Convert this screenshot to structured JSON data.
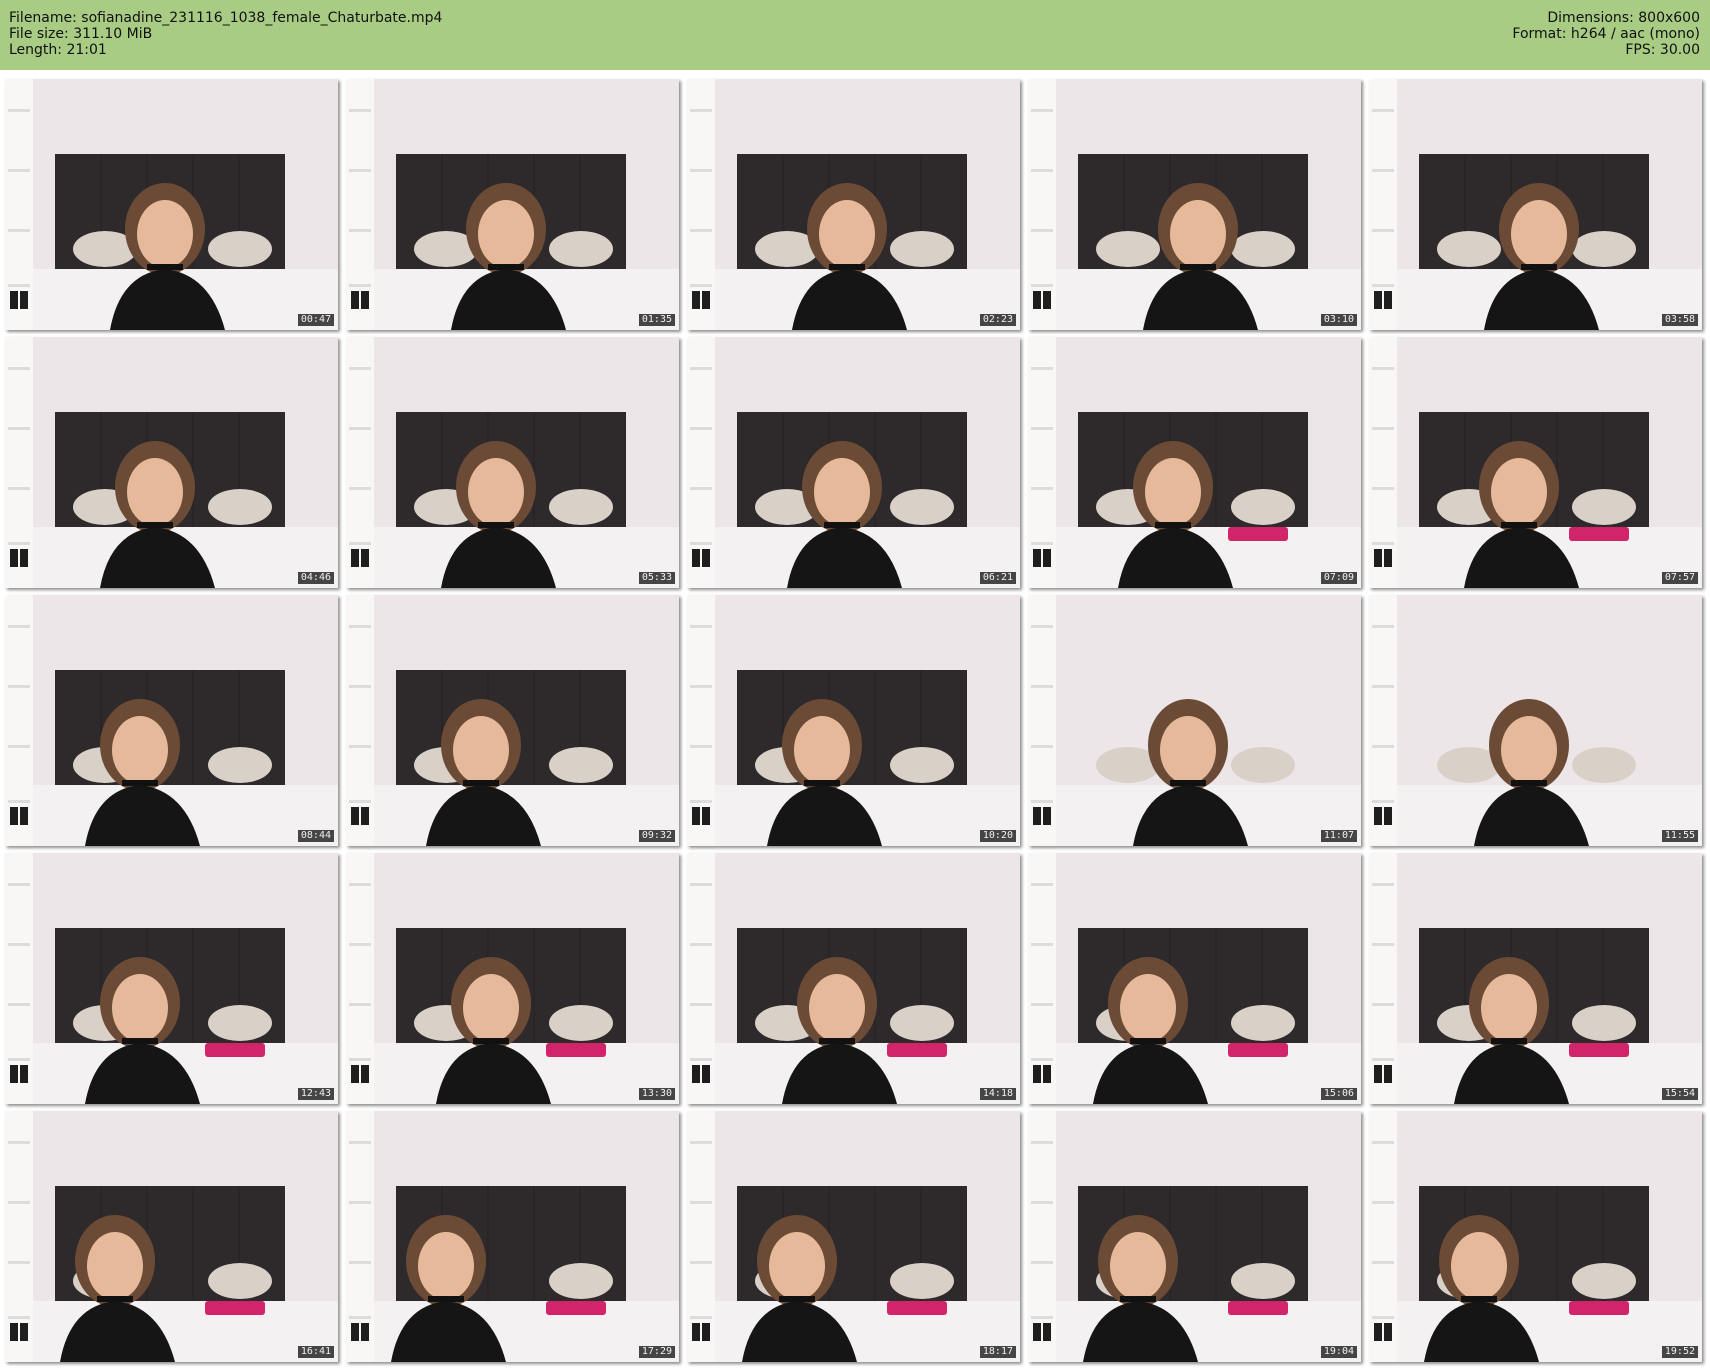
{
  "header": {
    "filename_label": "Filename: sofianadine_231116_1038_female_Chaturbate.mp4",
    "filesize_label": "File size: 311.10 MiB",
    "length_label": "Length: 21:01",
    "dimensions_label": "Dimensions: 800x600",
    "format_label": "Format: h264 / aac (mono)",
    "fps_label": "FPS: 30.00",
    "background_color": "#a9cc84"
  },
  "thumbnails": [
    {
      "timestamp": "00:47"
    },
    {
      "timestamp": "01:35"
    },
    {
      "timestamp": "02:23"
    },
    {
      "timestamp": "03:10"
    },
    {
      "timestamp": "03:58"
    },
    {
      "timestamp": "04:46"
    },
    {
      "timestamp": "05:33"
    },
    {
      "timestamp": "06:21"
    },
    {
      "timestamp": "07:09"
    },
    {
      "timestamp": "07:57"
    },
    {
      "timestamp": "08:44"
    },
    {
      "timestamp": "09:32"
    },
    {
      "timestamp": "10:20"
    },
    {
      "timestamp": "11:07"
    },
    {
      "timestamp": "11:55"
    },
    {
      "timestamp": "12:43"
    },
    {
      "timestamp": "13:30"
    },
    {
      "timestamp": "14:18"
    },
    {
      "timestamp": "15:06"
    },
    {
      "timestamp": "15:54"
    },
    {
      "timestamp": "16:41"
    },
    {
      "timestamp": "17:29"
    },
    {
      "timestamp": "18:17"
    },
    {
      "timestamp": "19:04"
    },
    {
      "timestamp": "19:52"
    }
  ]
}
